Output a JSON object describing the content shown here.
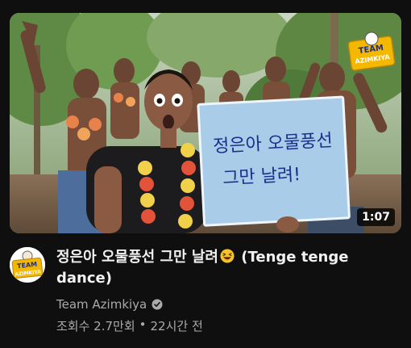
{
  "video": {
    "duration": "1:07",
    "thumbnail_sign_line1": "정은아 오물풍선",
    "thumbnail_sign_line2": "그만 날려!",
    "thumbnail_logo_line1": "TEAM",
    "thumbnail_logo_line2": "AZIMKIYA",
    "title": "정은아 오물풍선 그만 날려",
    "title_suffix": "(Tenge tenge dance)",
    "title_emoji": "laughing-face-emoji"
  },
  "channel": {
    "name": "Team Azimkiya",
    "verified_icon": "verified-check-icon",
    "avatar_line1": "TEAM",
    "avatar_line2": "AZIMKIYA"
  },
  "stats": {
    "views": "조회수 2.7만회",
    "separator": "•",
    "age": "22시간 전"
  },
  "colors": {
    "background": "#0f0f0f",
    "title": "#f1f1f1",
    "secondary_text": "#aaaaaa",
    "sign": "#a9cde8",
    "sign_text": "#1b2f8a"
  }
}
